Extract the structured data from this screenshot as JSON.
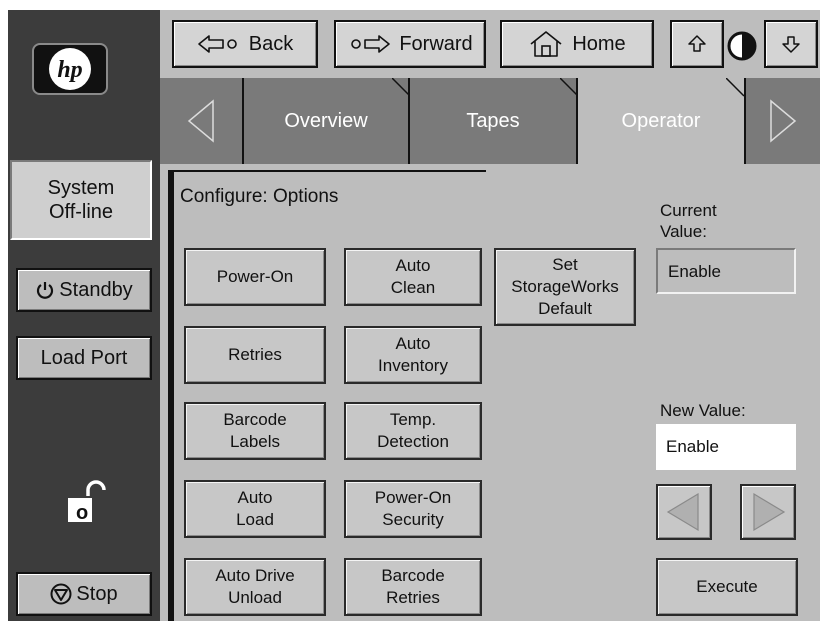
{
  "nav": {
    "back_label": "Back",
    "forward_label": "Forward",
    "home_label": "Home"
  },
  "tabs": [
    {
      "label": "Overview"
    },
    {
      "label": "Tapes"
    },
    {
      "label": "Operator"
    }
  ],
  "sidebar": {
    "status_line1": "System",
    "status_line2": "Off-line",
    "standby_label": "Standby",
    "load_port_label": "Load Port",
    "stop_label": "Stop",
    "lock_letter": "o"
  },
  "main": {
    "title": "Configure: Options",
    "options": [
      {
        "line1": "Power-On",
        "line2": ""
      },
      {
        "line1": "Auto",
        "line2": "Clean"
      },
      {
        "line1": "Retries",
        "line2": ""
      },
      {
        "line1": "Auto",
        "line2": "Inventory"
      },
      {
        "line1": "Barcode",
        "line2": "Labels"
      },
      {
        "line1": "Temp.",
        "line2": "Detection"
      },
      {
        "line1": "Auto",
        "line2": "Load"
      },
      {
        "line1": "Power-On",
        "line2": "Security"
      },
      {
        "line1": "Auto Drive",
        "line2": "Unload"
      },
      {
        "line1": "Barcode",
        "line2": "Retries"
      }
    ],
    "default_button": {
      "line1": "Set",
      "line2": "StorageWorks",
      "line3": "Default"
    },
    "current_value_label1": "Current",
    "current_value_label2": "Value:",
    "current_value": "Enable",
    "new_value_label": "New Value:",
    "new_value": "Enable",
    "execute_label": "Execute"
  }
}
